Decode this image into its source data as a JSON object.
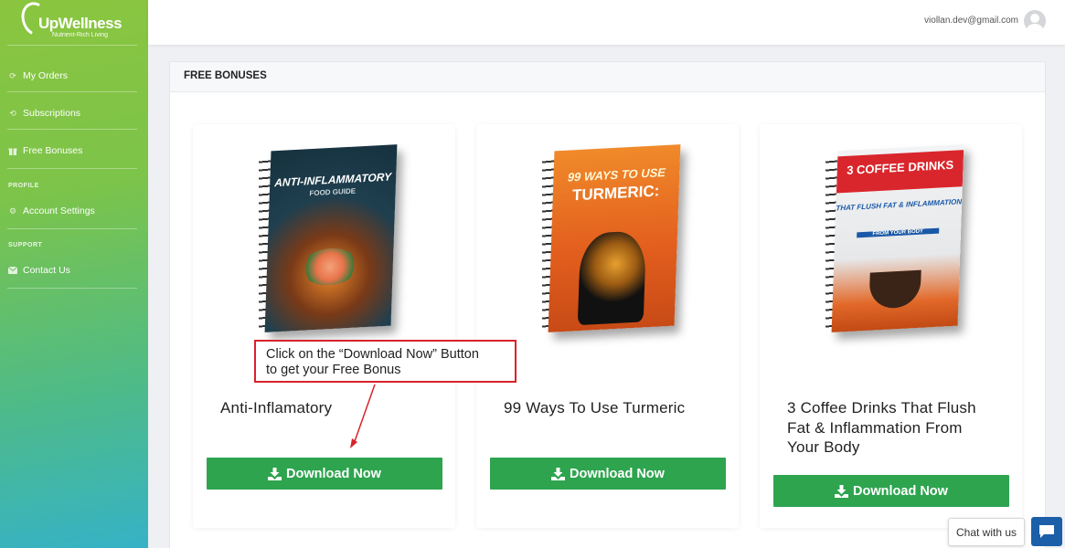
{
  "brand": {
    "name": "UpWellness",
    "tagline": "Nutrient-Rich Living"
  },
  "sidebar": {
    "items": [
      {
        "label": "My Orders",
        "icon": "refresh-icon"
      },
      {
        "label": "Subscriptions",
        "icon": "sync-icon"
      },
      {
        "label": "Free Bonuses",
        "icon": "gift-icon"
      }
    ],
    "profile_section": "PROFILE",
    "profile_items": [
      {
        "label": "Account Settings",
        "icon": "gear-icon"
      }
    ],
    "support_section": "SUPPORT",
    "support_items": [
      {
        "label": "Contact Us",
        "icon": "envelope-icon"
      }
    ]
  },
  "header": {
    "user_email": "viollan.dev@gmail.com"
  },
  "panel": {
    "title": "FREE BONUSES"
  },
  "bonuses": [
    {
      "title": "Anti-Inflamatory",
      "button": "Download Now",
      "cover": {
        "line1": "ANTI-INFLAMMATORY",
        "line2": "FOOD GUIDE",
        "color": "#1f3f4f"
      }
    },
    {
      "title": "99 Ways To Use Turmeric",
      "button": "Download Now",
      "cover": {
        "line1": "99 WAYS TO USE",
        "line2": "TURMERIC:",
        "color": "#e8742a"
      }
    },
    {
      "title": "3 Coffee Drinks That Flush Fat & Inflammation From Your Body",
      "button": "Download Now",
      "cover": {
        "line1": "3 COFFEE DRINKS",
        "line2": "THAT FLUSH FAT & INFLAMMATION",
        "line3": "FROM YOUR BODY",
        "color": "#e8e9eb"
      }
    }
  ],
  "callout": {
    "text_line1": "Click on the “Download Now” Button",
    "text_line2": "to get your Free Bonus",
    "color": "#d9232a"
  },
  "chat": {
    "label": "Chat with us"
  },
  "colors": {
    "accent_green": "#2ea44f",
    "chat_blue": "#1b5fa8",
    "sidebar_top": "#8bc53f",
    "sidebar_bottom": "#35b2c6"
  }
}
